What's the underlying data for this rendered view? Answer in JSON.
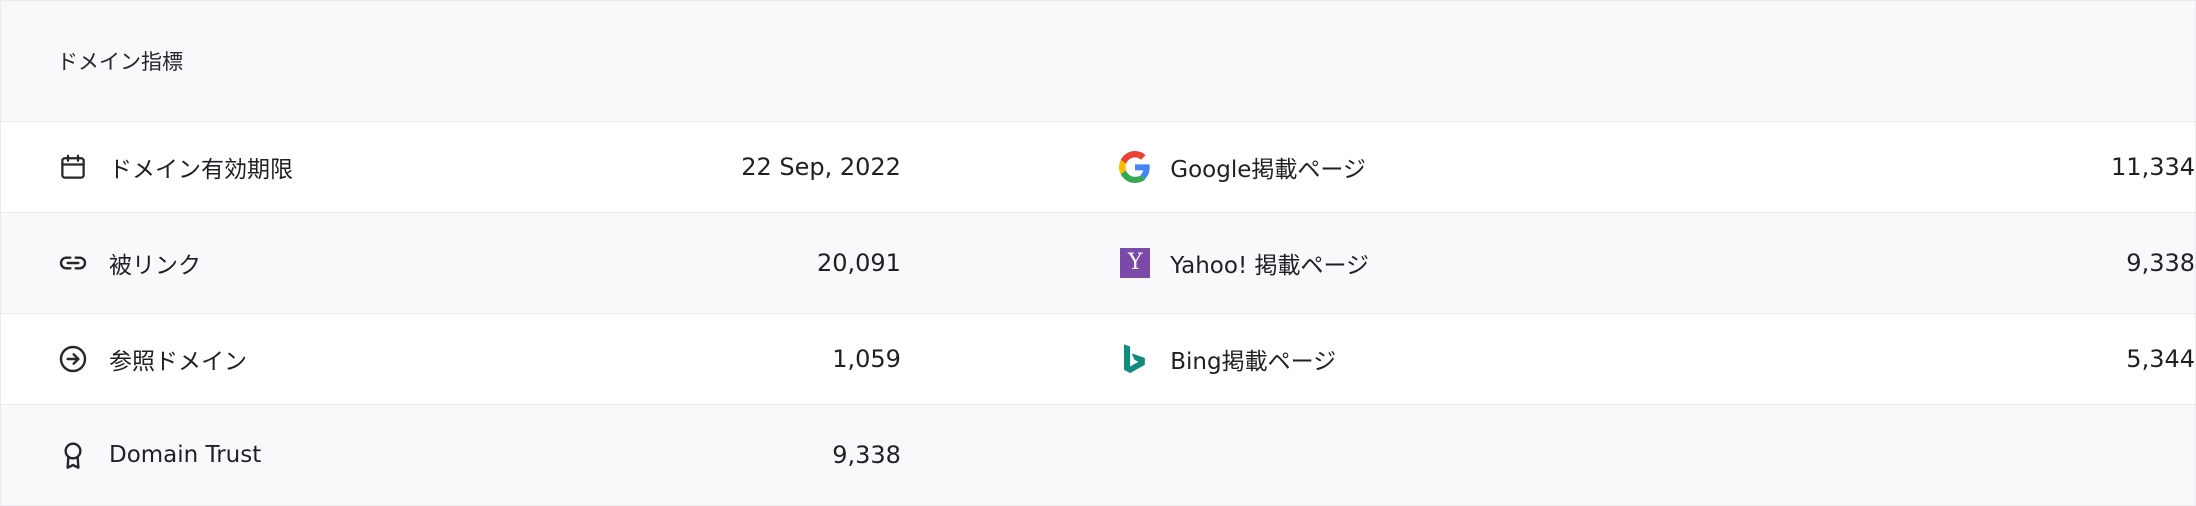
{
  "panel": {
    "title": "ドメイン指標"
  },
  "left_metrics": [
    {
      "icon": "calendar-icon",
      "label": "ドメイン有効期限",
      "value": "22 Sep, 2022"
    },
    {
      "icon": "link-icon",
      "label": "被リンク",
      "value": "20,091"
    },
    {
      "icon": "arrow-circle-right-icon",
      "label": "参照ドメイン",
      "value": "1,059"
    },
    {
      "icon": "award-ribbon-icon",
      "label": "Domain Trust",
      "value": "9,338"
    }
  ],
  "right_metrics": [
    {
      "icon": "google-logo-icon",
      "label": "Google掲載ページ",
      "value": "11,334"
    },
    {
      "icon": "yahoo-logo-icon",
      "label": "Yahoo! 掲載ページ",
      "value": "9,338"
    },
    {
      "icon": "bing-logo-icon",
      "label": "Bing掲載ページ",
      "value": "5,344"
    }
  ],
  "colors": {
    "background": "#f9f9fb",
    "row_alt": "#ffffff",
    "yahoo_purple": "#7b4aa8",
    "bing_teal": "#138a7e"
  }
}
